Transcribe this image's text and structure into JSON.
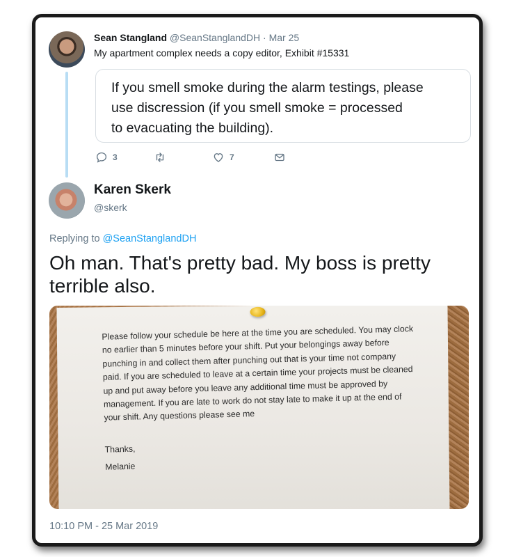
{
  "parent_tweet": {
    "author_name": "Sean Stangland",
    "author_handle": "@SeanStanglandDH",
    "separator": "·",
    "date": "Mar 25",
    "text": "My apartment complex needs a copy editor, Exhibit #15331",
    "quoted_lines": [
      "If you smell smoke during the alarm testings, please",
      "use discression (if you smell smoke = processed",
      "to evacuating the building)."
    ],
    "actions": {
      "reply_count": "3",
      "retweet_count": "",
      "like_count": "7"
    }
  },
  "reply_tweet": {
    "author_name": "Karen Skerk",
    "author_handle": "@skerk",
    "replying_prefix": "Replying to",
    "replying_to": "@SeanStanglandDH",
    "text": "Oh man. That's pretty bad. My boss is pretty terrible also.",
    "photo_note": {
      "body": "Please follow your schedule be here at the time you are scheduled. You may clock no earlier than 5 minutes before your shift. Put your belongings away before punching in and collect them after punching out that is your time not company paid. If you are scheduled to leave at a certain time your projects must be cleaned up and put away before you leave any additional time must be approved by management. If you are late to work do not stay late to make it up at the end of your shift. Any questions please see me",
      "signoff": "Thanks,",
      "signature": "Melanie"
    },
    "timestamp": "10:10 PM - 25 Mar 2019"
  },
  "colors": {
    "link": "#1da1f2",
    "muted": "#657786",
    "thread_line": "#b8ddf4"
  },
  "icons": [
    "reply-icon",
    "retweet-icon",
    "like-icon",
    "dm-icon"
  ]
}
